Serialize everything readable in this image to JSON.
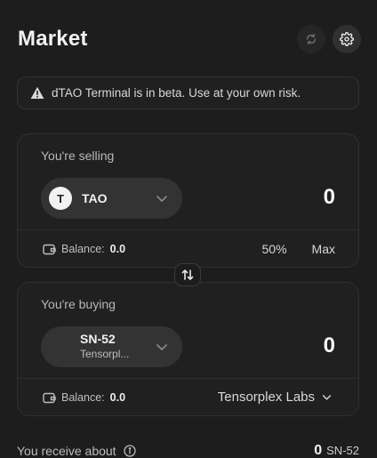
{
  "header": {
    "title": "Market",
    "refresh_icon": "refresh-icon",
    "settings_icon": "gear-icon"
  },
  "warning": {
    "text": "dTAO Terminal is in beta. Use at your own risk.",
    "icon": "warning-icon"
  },
  "selling": {
    "label": "You're selling",
    "token_logo": "T",
    "token_symbol": "TAO",
    "amount": "0",
    "balance_label": "Balance:",
    "balance_value": "0.0",
    "percent_label": "50%",
    "max_label": "Max"
  },
  "buying": {
    "label": "You're buying",
    "token_symbol": "SN-52",
    "token_name": "Tensorpl...",
    "amount": "0",
    "balance_label": "Balance:",
    "balance_value": "0.0",
    "subnet_name": "Tensorplex Labs"
  },
  "receive": {
    "label": "You receive about",
    "amount": "0",
    "unit": "SN-52"
  },
  "colors": {
    "background": "#1c1d1c",
    "card": "#1f201f",
    "pill": "#323332",
    "text": "#f2f2f2"
  }
}
